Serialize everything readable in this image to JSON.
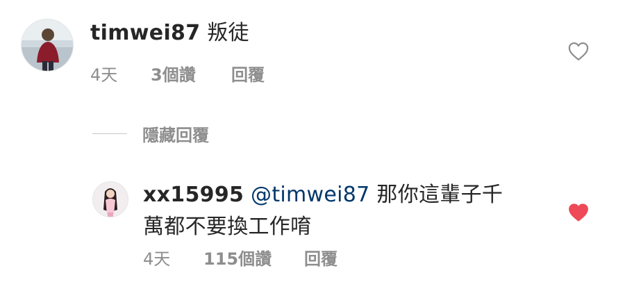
{
  "comment": {
    "username": "timwei87",
    "text": "叛徒",
    "time": "4天",
    "likes": "3個讚",
    "reply": "回覆",
    "liked": false
  },
  "hide_replies": {
    "label": "隱藏回覆"
  },
  "reply_comment": {
    "username": "xx15995",
    "mention": "@timwei87",
    "text_line1": "那你這輩子千",
    "text_line2": "萬都不要換工作唷",
    "time": "4天",
    "likes": "115個讚",
    "reply": "回覆",
    "liked": true
  },
  "colors": {
    "like_active": "#ed4956",
    "like_inactive": "#8e8e8e",
    "mention": "#00376b",
    "meta": "#8e8e8e"
  }
}
